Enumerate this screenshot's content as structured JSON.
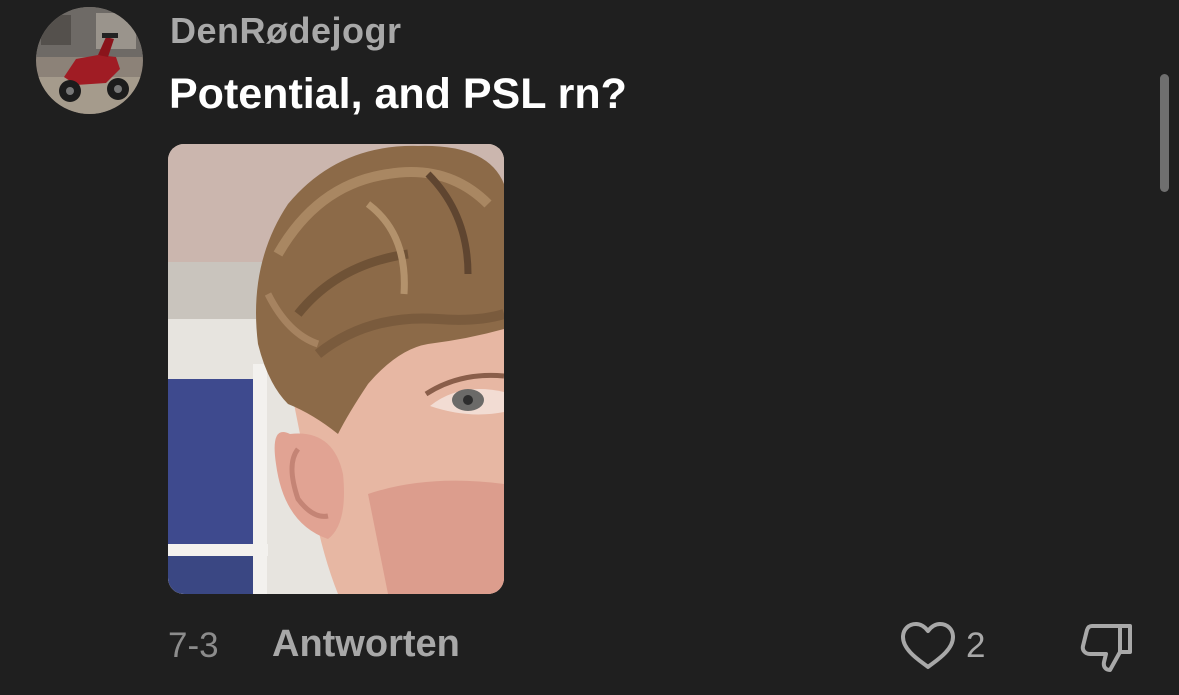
{
  "comment": {
    "username": "DenRødejogr",
    "text": "Potential, and PSL rn?",
    "date": "7-3",
    "reply_label": "Antworten",
    "like_count": "2"
  },
  "icons": {
    "like": "heart-icon",
    "dislike": "thumbs-down-icon"
  },
  "colors": {
    "background": "#1f1f1f",
    "text_primary": "#ffffff",
    "text_secondary": "#a8a8a8"
  }
}
